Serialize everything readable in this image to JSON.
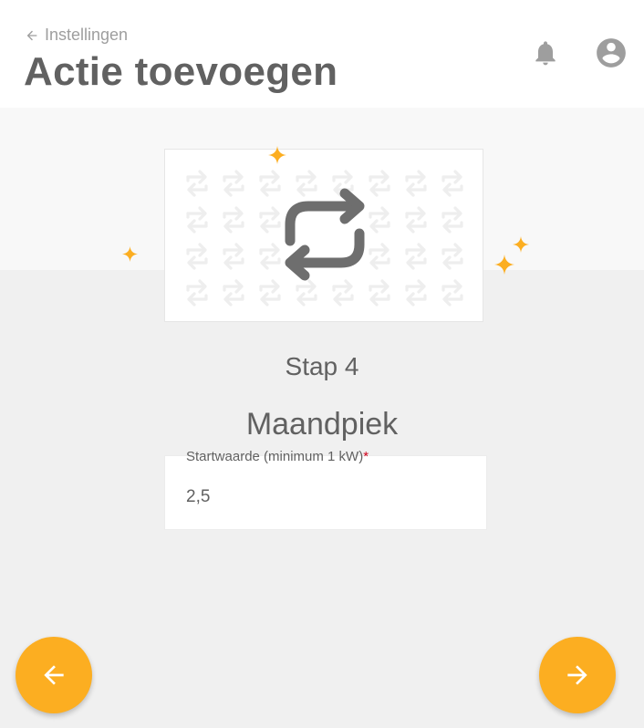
{
  "header": {
    "back_label": "Instellingen",
    "title": "Actie toevoegen",
    "icons": [
      "arrow-left-icon",
      "bell-icon",
      "account-circle-icon"
    ]
  },
  "hero": {
    "icon": "repeat-icon",
    "pattern_icon": "repeat-icon",
    "decoration": "sparkle-icon"
  },
  "step": {
    "label": "Stap 4",
    "action_name": "Maandpiek"
  },
  "form": {
    "start_value": {
      "label": "Startwaarde (minimum 1 kW)",
      "required_mark": "*",
      "value": "2,5"
    }
  },
  "navigation": {
    "previous_icon": "arrow-left-icon",
    "next_icon": "arrow-right-icon"
  },
  "colors": {
    "accent": "#fcae21",
    "text": "#616161",
    "muted": "#9e9e9e",
    "required": "#d0021b",
    "background": "#f0f0f0"
  }
}
